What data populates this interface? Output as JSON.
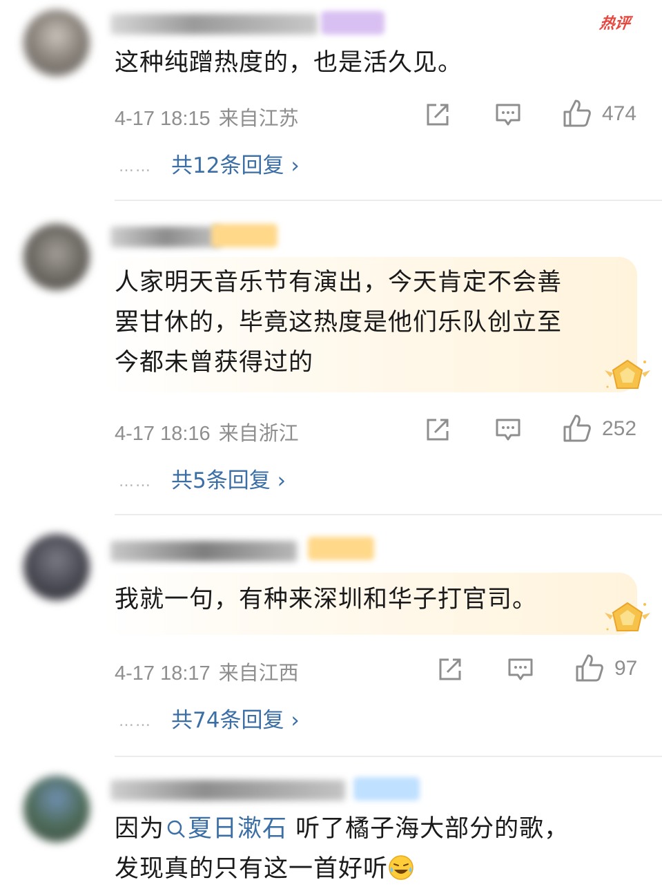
{
  "comments": [
    {
      "hot_tag": "热评",
      "text_lines": [
        "这种纯蹭热度的，也是活久见。"
      ],
      "date": "4-17 18:15",
      "location": "来自江苏",
      "likes": "474",
      "dots": "……",
      "replies": "共12条回复"
    },
    {
      "text_lines": [
        "人家明天音乐节有演出，今天肯定不会善",
        "罢甘休的，毕竟这热度是他们乐队创立至",
        "今都未曾获得过的"
      ],
      "date": "4-17 18:16",
      "location": "来自浙江",
      "likes": "252",
      "dots": "……",
      "replies": "共5条回复"
    },
    {
      "text_lines": [
        "我就一句，有种来深圳和华子打官司。"
      ],
      "date": "4-17 18:17",
      "location": "来自江西",
      "likes": "97",
      "dots": "……",
      "replies": "共74条回复"
    },
    {
      "text_prefix": "因为",
      "topic_link": "夏日漱石",
      "text_suffix": " 听了橘子海大部分的歌，",
      "text_line2": "发现真的只有这一首好听"
    }
  ],
  "icons": {
    "share": "share-icon",
    "comment": "comment-icon",
    "like": "thumbs-up-icon",
    "search": "search-icon",
    "emoji": "laughing-crying-emoji-icon"
  },
  "colors": {
    "link": "#3a6ea5",
    "meta": "#8e8e8e",
    "hot": "#e8453c"
  }
}
